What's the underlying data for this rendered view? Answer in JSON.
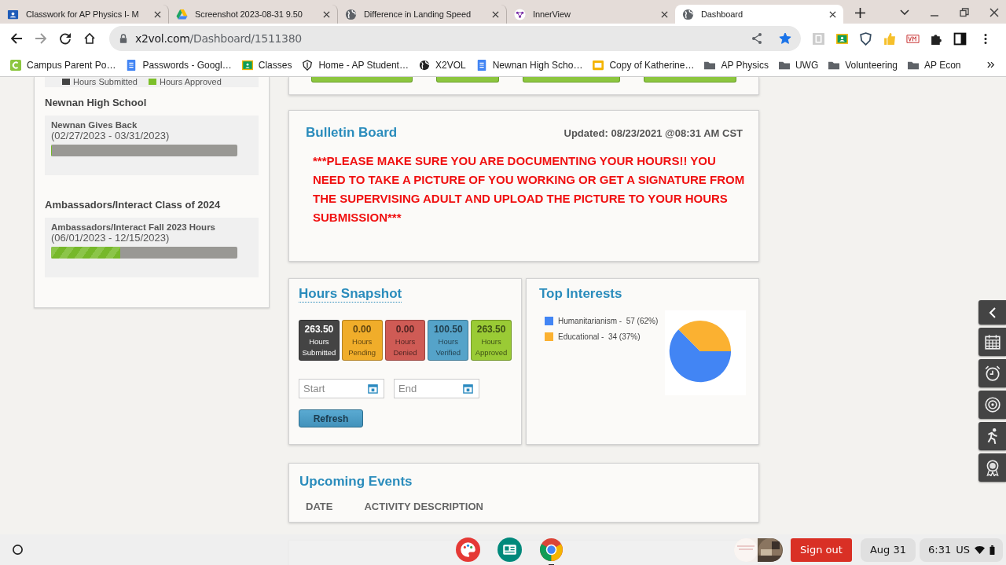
{
  "browser": {
    "tabs": [
      {
        "title": "Classwork for AP Physics I- M",
        "selected": false
      },
      {
        "title": "Screenshot 2023-08-31 9.50",
        "selected": false
      },
      {
        "title": "Difference in Landing Speed",
        "selected": false
      },
      {
        "title": "InnerView",
        "selected": false
      },
      {
        "title": "Dashboard",
        "selected": true
      }
    ],
    "address": {
      "host": "x2vol.com",
      "path": "/Dashboard/1511380"
    },
    "bookmarked": true,
    "bookmarks": [
      {
        "label": "Campus Parent Po…",
        "kind": "campus"
      },
      {
        "label": "Passwords - Googl…",
        "kind": "doc"
      },
      {
        "label": "Classes",
        "kind": "classroom"
      },
      {
        "label": "Home - AP Student…",
        "kind": "shield"
      },
      {
        "label": "X2VOL",
        "kind": "globe"
      },
      {
        "label": "Newnan High Scho…",
        "kind": "doc"
      },
      {
        "label": "Copy of Katherine…",
        "kind": "slides"
      },
      {
        "label": "AP Physics",
        "kind": "folder"
      },
      {
        "label": "UWG",
        "kind": "folder"
      },
      {
        "label": "Volunteering",
        "kind": "folder"
      },
      {
        "label": "AP Econ",
        "kind": "folder"
      }
    ]
  },
  "goals": {
    "legend": [
      {
        "label": "Hours Submitted",
        "color": "#444444"
      },
      {
        "label": "Hours Approved",
        "color": "#7cbf2a"
      }
    ],
    "groups": [
      {
        "name": "Newnan High School",
        "goals": [
          {
            "title": "Newnan Gives Back",
            "dates": "(02/27/2023 - 03/31/2023)",
            "level": 0
          }
        ]
      },
      {
        "name": "Ambassadors/Interact Class of 2024",
        "goals": [
          {
            "title": "Ambassadors/Interact Fall 2023 Hours",
            "dates": "(06/01/2023 - 12/15/2023)",
            "level": 0.37
          }
        ]
      }
    ]
  },
  "bulletin": {
    "title": "Bulletin Board",
    "updated": "Updated: 08/23/2021 @08:31 AM CST",
    "message": "***PLEASE MAKE SURE YOU ARE DOCUMENTING YOUR HOURS!! YOU NEED TO TAKE A PICTURE OF YOU WORKING OR GET A SIGNATURE FROM THE SUPERVISING ADULT AND UPLOAD THE PICTURE TO YOUR HOURS SUBMISSION***"
  },
  "snapshot": {
    "title": "Hours Snapshot",
    "tiles": [
      {
        "value": "263.50",
        "label": "Hours Submitted",
        "color": "#444444"
      },
      {
        "value": "0.00",
        "label": "Hours Pending",
        "color": "#f0ad2a"
      },
      {
        "value": "0.00",
        "label": "Hours Denied",
        "color": "#cf5b55"
      },
      {
        "value": "100.50",
        "label": "Hours Verified",
        "color": "#55a3c9"
      },
      {
        "value": "263.50",
        "label": "Hours Approved",
        "color": "#9acb35"
      }
    ],
    "start": {
      "placeholder": "Start"
    },
    "end": {
      "placeholder": "End"
    },
    "refresh": "Refresh"
  },
  "interests": {
    "title": "Top Interests",
    "legend": [
      {
        "color": "#4285f4"
      },
      {
        "color": "#fbb131"
      }
    ],
    "chart_data": {
      "type": "pie",
      "categories": [
        "Humanitarianism -  57 (62%)",
        "Educational -  34 (37%)"
      ],
      "values": [
        62.6,
        37.4
      ]
    }
  },
  "upcoming": {
    "title": "Upcoming Events",
    "columns": [
      "DATE",
      "ACTIVITY DESCRIPTION"
    ]
  },
  "shelf": {
    "sign_out": "Sign out",
    "date": "Aug 31",
    "time": "6:31",
    "locale": "US"
  }
}
